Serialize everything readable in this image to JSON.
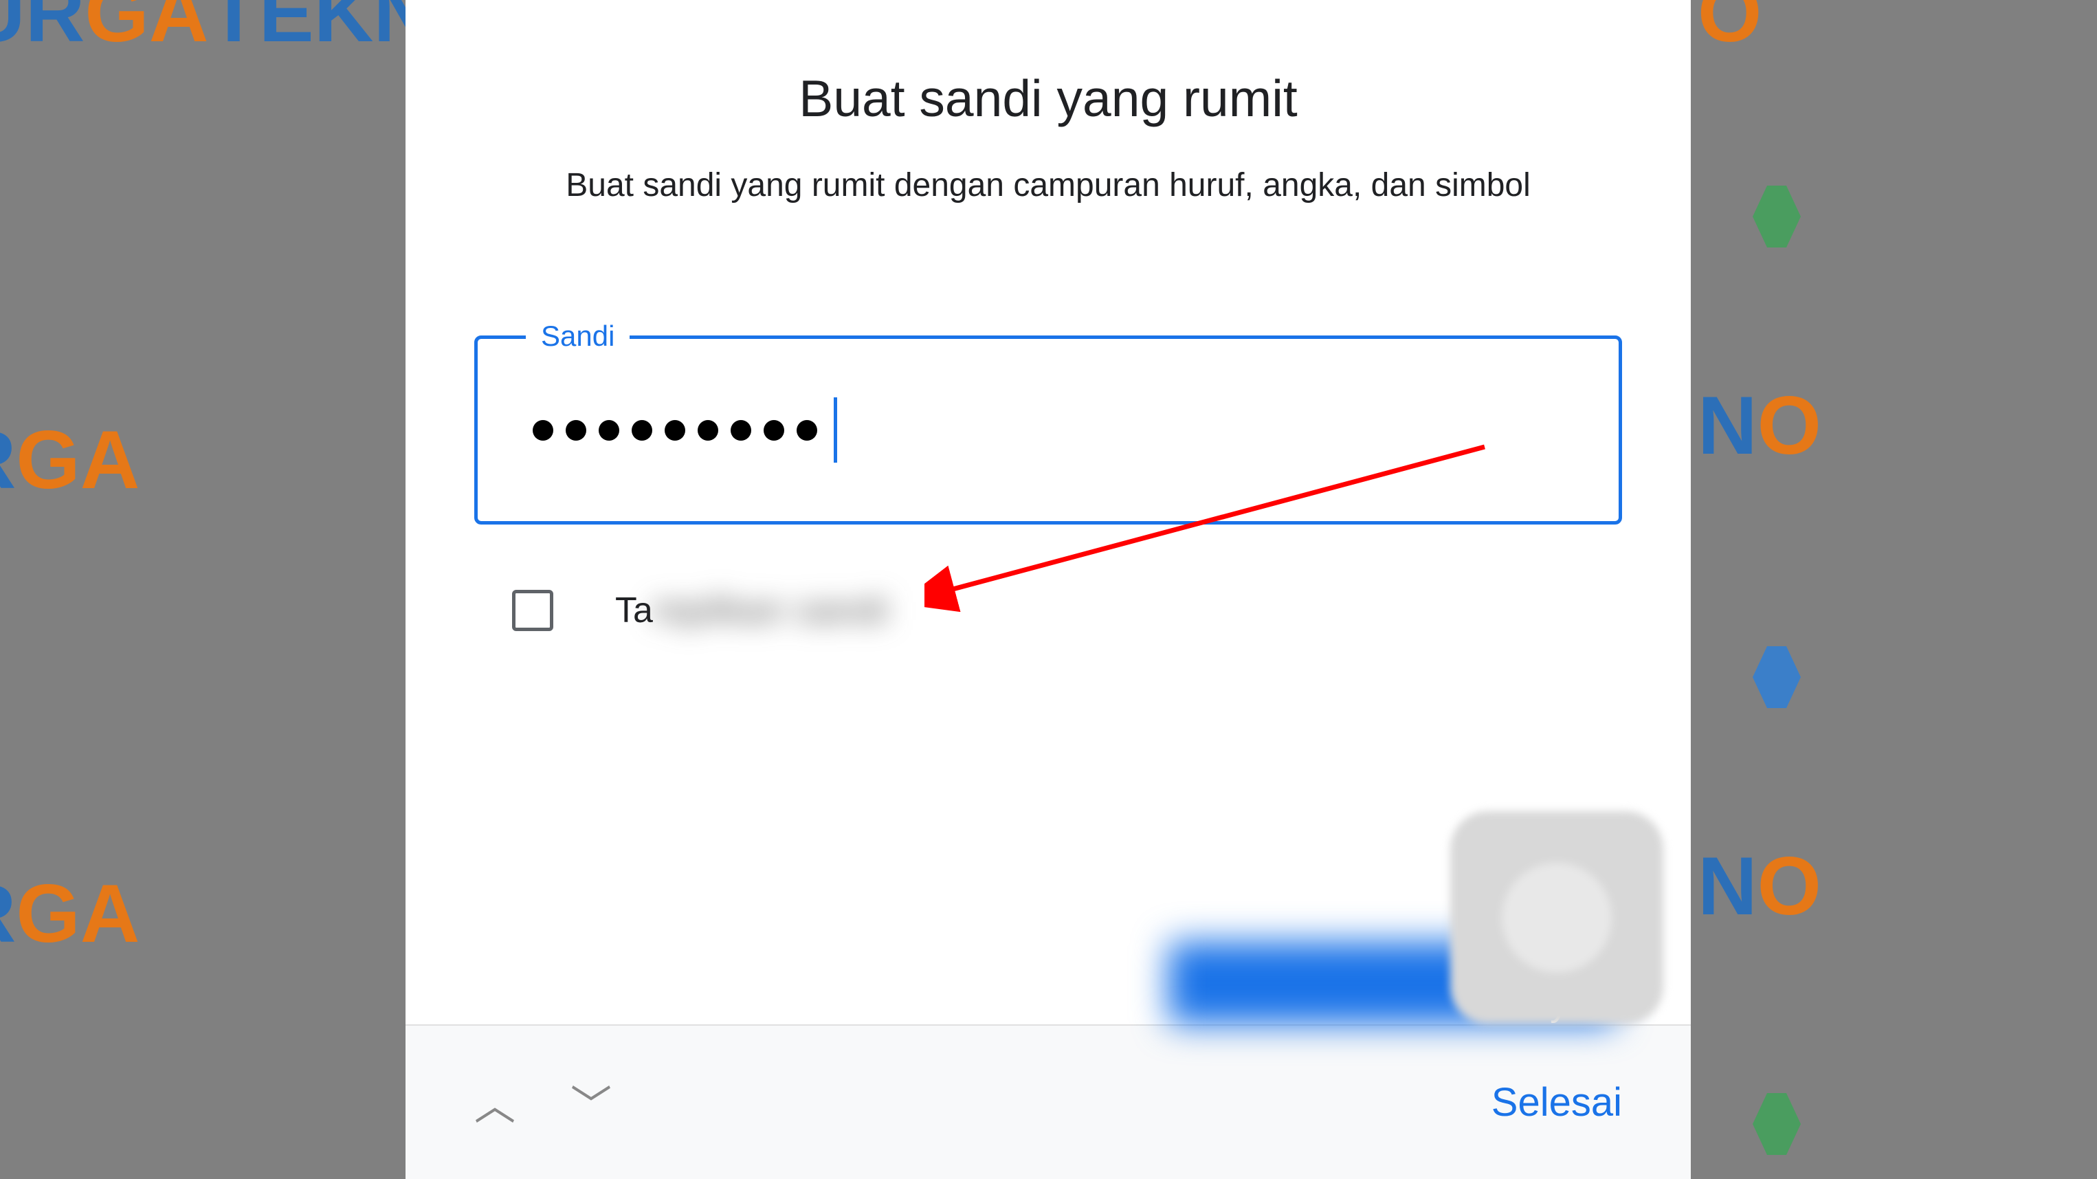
{
  "watermark": {
    "brand_part1": "SUR",
    "brand_part2": "GA",
    "brand_part3": " TEKN",
    "brand_part4": "O"
  },
  "form": {
    "title": "Buat sandi yang rumit",
    "subtitle": "Buat sandi yang rumit dengan campuran huruf, angka, dan simbol",
    "field_label": "Sandi",
    "password_dots_count": 9,
    "show_password_prefix": "Ta",
    "show_password_blurred": "mpilkan sandi",
    "next_button_suffix": "nya"
  },
  "keyboard": {
    "done_label": "Selesai"
  },
  "colors": {
    "primary": "#1a73e8",
    "text": "#202124",
    "watermark_blue": "#2c6fb8",
    "watermark_orange": "#e67817"
  }
}
